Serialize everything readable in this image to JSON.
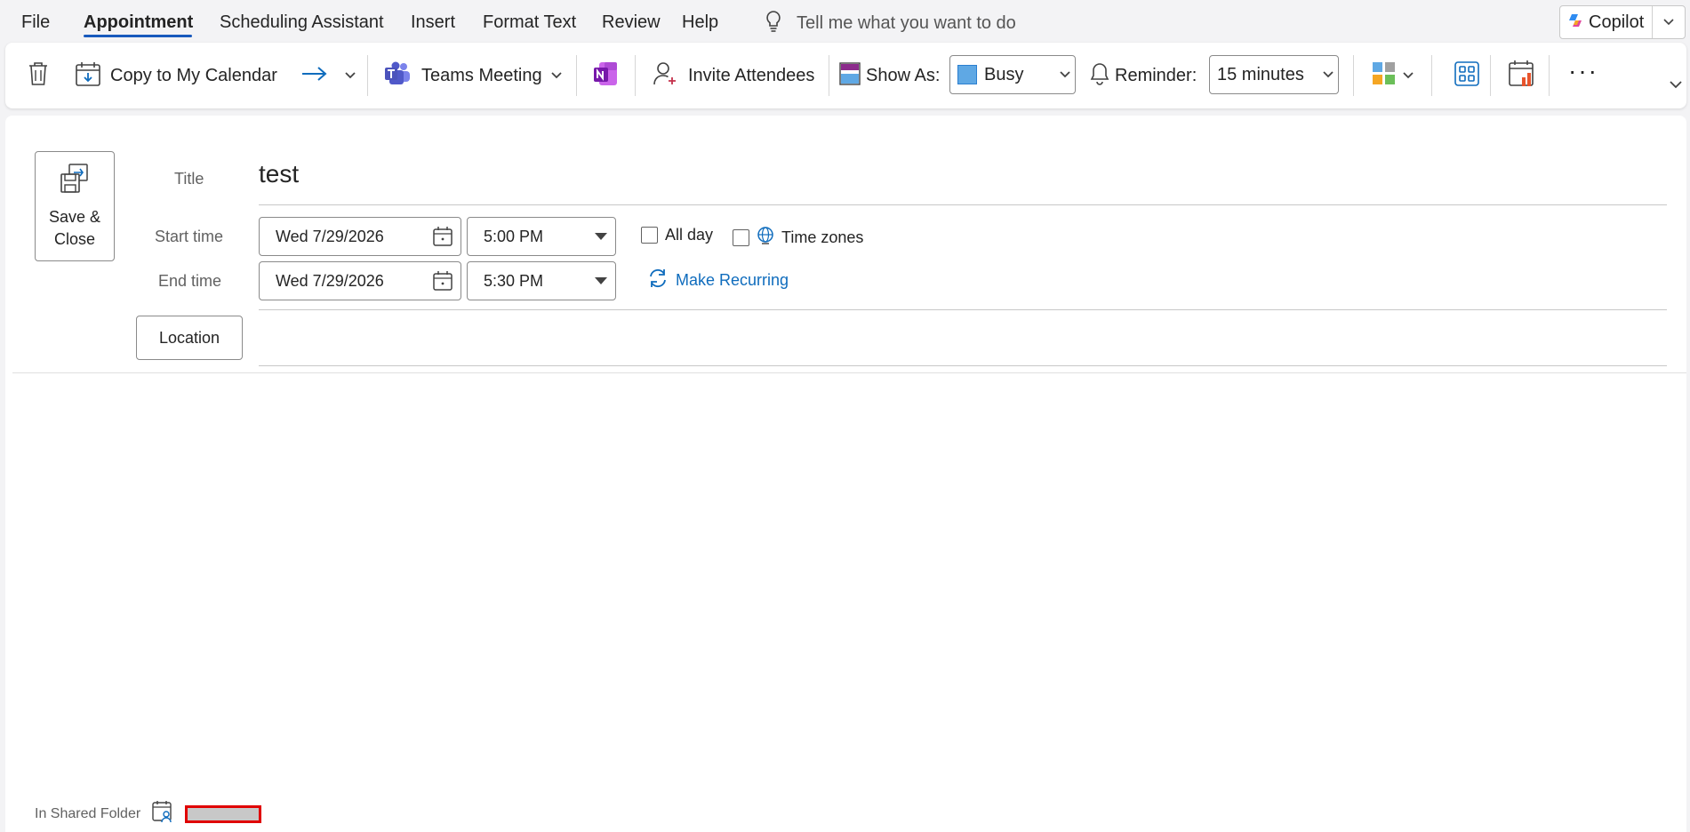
{
  "menubar": {
    "items": [
      "File",
      "Appointment",
      "Scheduling Assistant",
      "Insert",
      "Format Text",
      "Review",
      "Help"
    ],
    "active": "Appointment",
    "tell_me": "Tell me what you want to do",
    "copilot": "Copilot"
  },
  "ribbon": {
    "copy_to_calendar": "Copy to My Calendar",
    "teams_meeting": "Teams Meeting",
    "invite_attendees": "Invite Attendees",
    "show_as_label": "Show As:",
    "show_as_value": "Busy",
    "reminder_label": "Reminder:",
    "reminder_value": "15 minutes",
    "more": "···"
  },
  "form": {
    "save_close": "Save & Close",
    "title_label": "Title",
    "title_value": "test",
    "start_label": "Start time",
    "start_date": "Wed 7/29/2026",
    "start_time": "5:00 PM",
    "end_label": "End time",
    "end_date": "Wed 7/29/2026",
    "end_time": "5:30 PM",
    "all_day": "All day",
    "all_day_checked": false,
    "time_zones": "Time zones",
    "time_zones_checked": false,
    "make_recurring": "Make Recurring",
    "location_button": "Location",
    "location_value": ""
  },
  "footer": {
    "shared_folder": "In Shared Folder"
  },
  "colors": {
    "accent": "#185abd",
    "link": "#0f6cbd",
    "busy": "#5fa8e4",
    "redaction": "#e00000"
  }
}
